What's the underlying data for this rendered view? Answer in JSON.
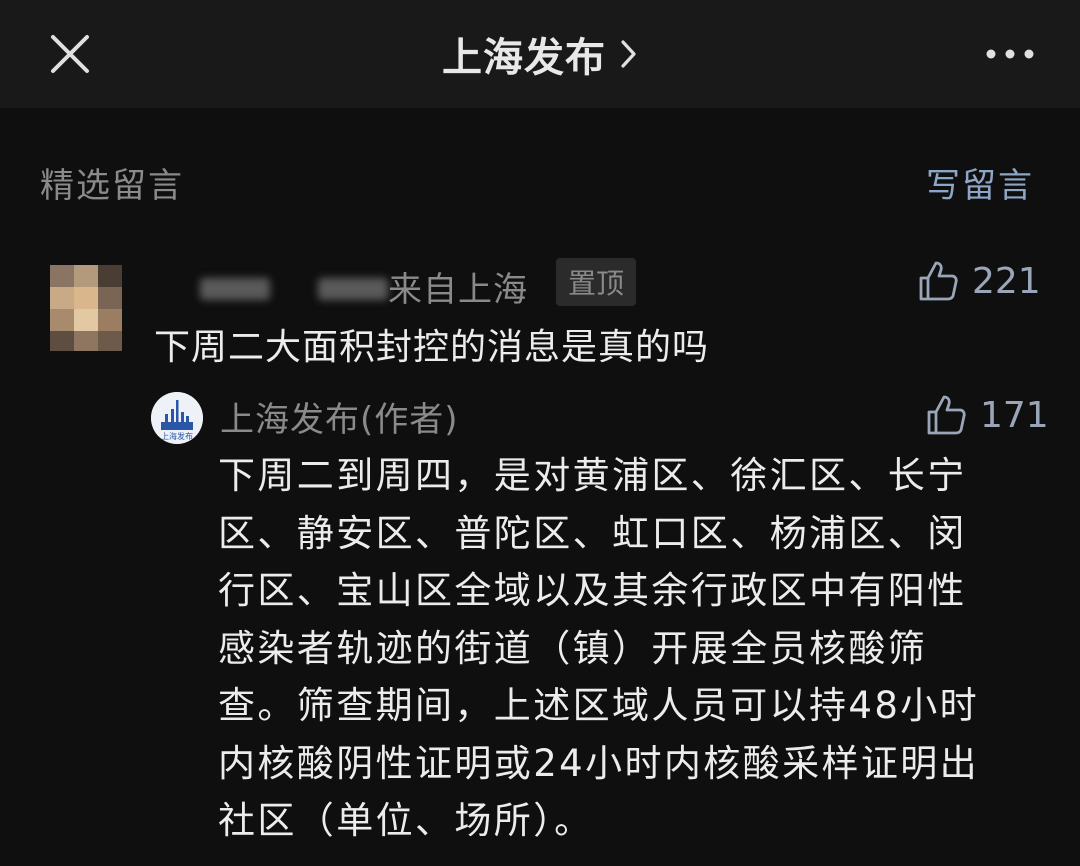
{
  "header": {
    "title": "上海发布",
    "close_icon": "close-icon",
    "chevron_icon": "chevron-right-icon",
    "more_icon": "more-dots-icon"
  },
  "section": {
    "label": "精选留言",
    "write_label": "写留言"
  },
  "comment": {
    "from_text": "来自上海",
    "pinned_label": "置顶",
    "likes": "221",
    "text": "下周二大面积封控的消息是真的吗"
  },
  "reply": {
    "author": "上海发布(作者)",
    "likes": "171",
    "lines": [
      "下周二到周四，是对黄浦区、徐汇区、长宁",
      "区、静安区、普陀区、虹口区、杨浦区、闵",
      "行区、宝山区全域以及其余行政区中有阳性",
      "感染者轨迹的街道（镇）开展全员核酸筛",
      "查。筛查期间，上述区域人员可以持48小时",
      "内核酸阴性证明或24小时内核酸采样证明出",
      "社区（单位、场所）。"
    ]
  },
  "colors": {
    "background": "#0f0f0f",
    "topbar": "#191919",
    "link_blue": "#8ea6c6",
    "muted": "#8a8a8a"
  }
}
